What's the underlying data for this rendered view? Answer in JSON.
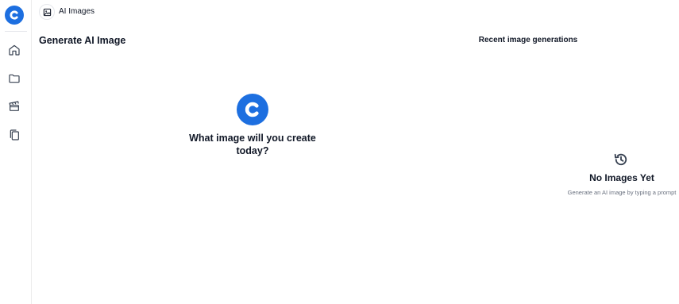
{
  "app": {
    "brand_color": "#1d6fe0"
  },
  "sidebar": {
    "items": [
      {
        "icon": "home-icon"
      },
      {
        "icon": "folder-icon"
      },
      {
        "icon": "clapperboard-icon"
      },
      {
        "icon": "copy-icon"
      }
    ]
  },
  "breadcrumb": {
    "icon": "image-icon",
    "label": "AI Images"
  },
  "main": {
    "title": "Generate AI Image",
    "hero_prompt": "What image will you create today?"
  },
  "recent": {
    "title": "Recent image generations",
    "empty_icon": "history-icon",
    "empty_title": "No Images Yet",
    "empty_subtitle": "Generate an AI image by typing a prompt"
  }
}
